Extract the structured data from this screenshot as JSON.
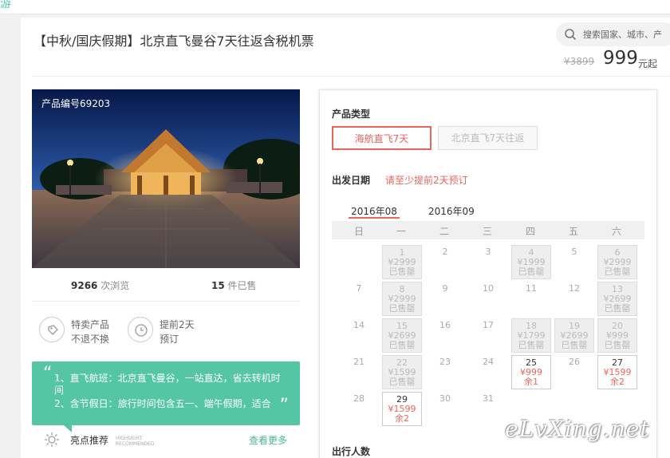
{
  "header": {
    "title": "【中秋/国庆假期】北京直飞曼谷7天往返含税机票",
    "search_placeholder": "搜索国家、城市、产",
    "old_price": "¥3899",
    "price": "999",
    "price_unit": "元起"
  },
  "product": {
    "code": "产品编号69203",
    "views_num": "9266",
    "views_label": "次浏览",
    "sold_num": "15",
    "sold_label": "件已售",
    "features": [
      {
        "icon": "tag-icon",
        "line1": "特卖产品",
        "line2": "不退不换"
      },
      {
        "icon": "clock-icon",
        "line1": "提前2天",
        "line2": "预订"
      }
    ]
  },
  "highlight": {
    "line1": "1、直飞航班：北京直飞曼谷，一站直达，省去转机时间",
    "line2": "2、含节假日：旅行时间包含五一、端午假期，适合",
    "title": "亮点推荐",
    "title_en": "HIGHLIGHT RECOMMENDED",
    "more": "查看更多"
  },
  "booking": {
    "type_label": "产品类型",
    "options": [
      "海航直飞7天",
      "北京直飞7天往返"
    ],
    "date_label": "出发日期",
    "date_note": "请至少提前2天预订",
    "months": [
      "2016年08",
      "2016年09"
    ],
    "weekdays": [
      "日",
      "一",
      "二",
      "三",
      "四",
      "五",
      "六"
    ],
    "travelers_label": "出行人数",
    "calendar": [
      {
        "d": "1",
        "s": "sold",
        "p": "¥2999",
        "n": "已售罄"
      },
      {
        "d": "2",
        "s": "plain"
      },
      {
        "d": "3",
        "s": "plain"
      },
      {
        "d": "4",
        "s": "sold",
        "p": "¥1999",
        "n": "已售罄"
      },
      {
        "d": "5",
        "s": "plain"
      },
      {
        "d": "6",
        "s": "sold",
        "p": "¥2999",
        "n": "已售罄"
      },
      {
        "d": "7",
        "s": "plain"
      },
      {
        "d": "8",
        "s": "sold",
        "p": "¥2999",
        "n": "已售罄"
      },
      {
        "d": "9",
        "s": "plain"
      },
      {
        "d": "10",
        "s": "plain"
      },
      {
        "d": "11",
        "s": "plain"
      },
      {
        "d": "12",
        "s": "plain"
      },
      {
        "d": "13",
        "s": "sold",
        "p": "¥2699",
        "n": "已售罄"
      },
      {
        "d": "14",
        "s": "plain"
      },
      {
        "d": "15",
        "s": "sold",
        "p": "¥2699",
        "n": "已售罄"
      },
      {
        "d": "16",
        "s": "plain"
      },
      {
        "d": "17",
        "s": "plain"
      },
      {
        "d": "18",
        "s": "sold",
        "p": "¥1799",
        "n": "已售罄"
      },
      {
        "d": "19",
        "s": "sold",
        "p": "¥2699",
        "n": "已售罄"
      },
      {
        "d": "20",
        "s": "sold",
        "p": "¥999",
        "n": "已售罄"
      },
      {
        "d": "21",
        "s": "plain"
      },
      {
        "d": "22",
        "s": "sold",
        "p": "¥1599",
        "n": "已售罄"
      },
      {
        "d": "23",
        "s": "plain"
      },
      {
        "d": "24",
        "s": "plain"
      },
      {
        "d": "25",
        "s": "avail",
        "p": "¥999",
        "n": "余1"
      },
      {
        "d": "26",
        "s": "plain"
      },
      {
        "d": "27",
        "s": "avail",
        "p": "¥1599",
        "n": "余2"
      },
      {
        "d": "28",
        "s": "plain"
      },
      {
        "d": "29",
        "s": "avail",
        "p": "¥1599",
        "n": "余2"
      },
      {
        "d": "30",
        "s": "plain"
      },
      {
        "d": "31",
        "s": "plain"
      }
    ]
  },
  "watermark": "eLvXing.net",
  "colors": {
    "accent": "#e8655d",
    "green": "#54c6a4"
  }
}
